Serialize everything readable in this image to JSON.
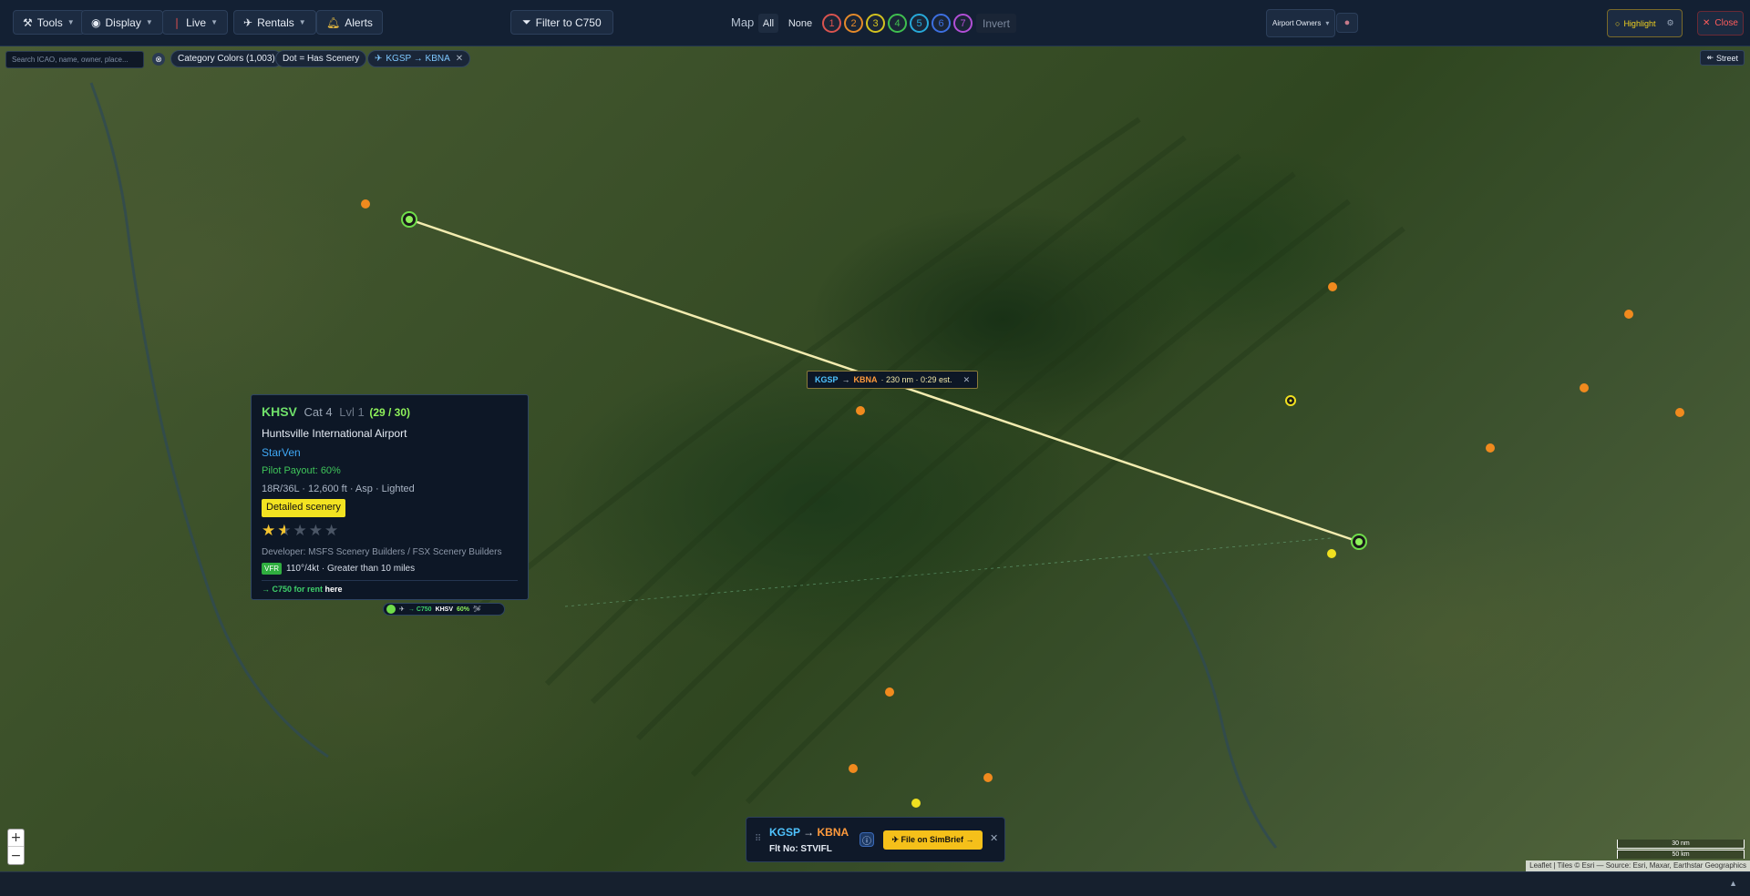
{
  "toolbar": {
    "tools": "Tools",
    "display": "Display",
    "live": "Live",
    "rentals": "Rentals",
    "alerts": "Alerts",
    "filter": "Filter to C750",
    "map_label": "Map",
    "all": "All",
    "none": "None",
    "categories": [
      "1",
      "2",
      "3",
      "4",
      "5",
      "6",
      "7"
    ],
    "category_colors": [
      "#d9534f",
      "#e58a2a",
      "#d4c21f",
      "#3fbf4f",
      "#27a9d9",
      "#3d6fe0",
      "#b24fd6"
    ],
    "invert": "Invert",
    "owners": "Airport Owners",
    "highlight": "Highlight",
    "close": "Close"
  },
  "filters": {
    "search_placeholder": "Search ICAO, name, owner, place...",
    "category_colors": "Category Colors (1,003)",
    "dot_scenery": "Dot = Has Scenery",
    "route_chip": "KGSP → KBNA",
    "street": "Street"
  },
  "route": {
    "from": "KGSP",
    "arrow": "→",
    "to": "KBNA",
    "info": "· 230 nm · 0:29 est."
  },
  "popup": {
    "icao": "KHSV",
    "cat": "Cat 4",
    "lvl": "Lvl 1",
    "slots": "(29 / 30)",
    "name": "Huntsville International Airport",
    "owner": "StarVen",
    "payout": "Pilot Payout: 60%",
    "runway": "18R/36L · 12,600 ft · Asp · Lighted",
    "scenery_badge": "Detailed scenery",
    "rating": 1.5,
    "rating_max": 5,
    "developer": "Developer: MSFS Scenery Builders / FSX Scenery Builders",
    "vfr": "VFR",
    "wx": "110°/4kt · Greater than 10 miles",
    "rent_prefix": "→ C750 for rent",
    "rent_link": "here"
  },
  "plane_tag": {
    "type": "→ C750",
    "icao": "KHSV",
    "pct": "60%"
  },
  "flight_card": {
    "from": "KGSP",
    "arrow": "→",
    "to": "KBNA",
    "flight_no": "Flt No: STVIFL",
    "simbrief": "✈ File on SimBrief →"
  },
  "scale": {
    "top": "30 nm",
    "bottom": "50 km"
  },
  "attribution": "Leaflet | Tiles © Esri — Source: Esri, Maxar, Earthstar Geographics"
}
